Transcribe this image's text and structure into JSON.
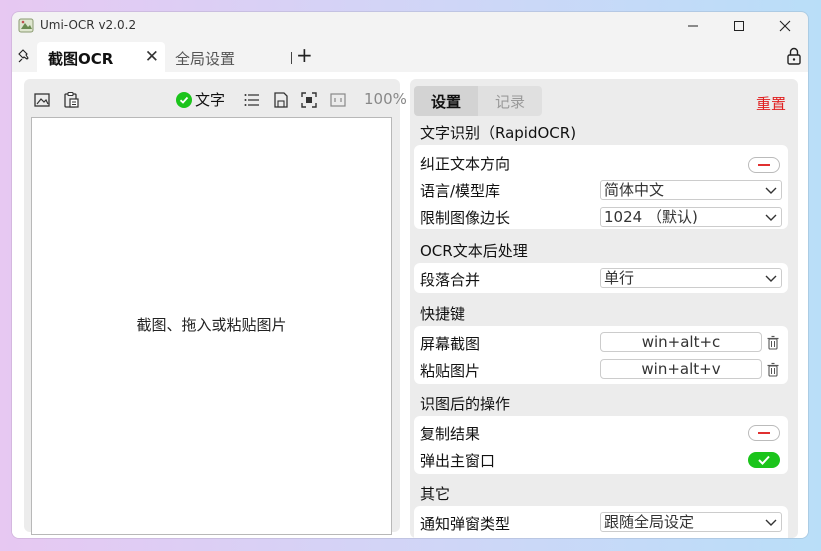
{
  "window": {
    "title": "Umi-OCR v2.0.2",
    "controls": {
      "minimize": "—",
      "maximize": "☐",
      "close": "✕"
    }
  },
  "tabs": {
    "active": {
      "label": "截图OCR",
      "close": "✕"
    },
    "inactive": {
      "label": "全局设置"
    },
    "add": "+"
  },
  "left_panel": {
    "text_toggle_label": "文字",
    "zoom": "100%",
    "image_hint": "截图、拖入或粘贴图片"
  },
  "right_panel": {
    "segments": {
      "settings": "设置",
      "records": "记录"
    },
    "reset": "重置",
    "sections": [
      {
        "title": "文字识别（RapidOCR)",
        "rows": [
          {
            "label": "纠正文本方向",
            "type": "toggle",
            "value": false
          },
          {
            "label": "语言/模型库",
            "type": "select",
            "value": "简体中文"
          },
          {
            "label": "限制图像边长",
            "type": "select",
            "value": "1024 （默认)"
          }
        ]
      },
      {
        "title": "OCR文本后处理",
        "rows": [
          {
            "label": "段落合并",
            "type": "select",
            "value": "单行"
          }
        ]
      },
      {
        "title": "快捷键",
        "rows": [
          {
            "label": "屏幕截图",
            "type": "hotkey",
            "value": "win+alt+c"
          },
          {
            "label": "粘贴图片",
            "type": "hotkey",
            "value": "win+alt+v"
          }
        ]
      },
      {
        "title": "识图后的操作",
        "rows": [
          {
            "label": "复制结果",
            "type": "toggle",
            "value": false
          },
          {
            "label": "弹出主窗口",
            "type": "toggle",
            "value": true
          }
        ]
      },
      {
        "title": "其它",
        "rows": [
          {
            "label": "通知弹窗类型",
            "type": "select",
            "value": "跟随全局设定"
          }
        ]
      }
    ]
  },
  "colors": {
    "accent_green": "#1bc41b",
    "reset_red": "#e02020",
    "toggle_off_mark": "#e03030"
  },
  "icons": {
    "app": "app-icon",
    "pin": "pin-icon",
    "lock": "lock-icon",
    "image": "image-icon",
    "clipboard": "clipboard-icon",
    "list": "list-icon",
    "save": "save-icon",
    "screenshot": "screenshot-frame-icon",
    "fit": "fit-window-icon",
    "chevron": "chevron-down-icon",
    "trash": "trash-icon"
  }
}
